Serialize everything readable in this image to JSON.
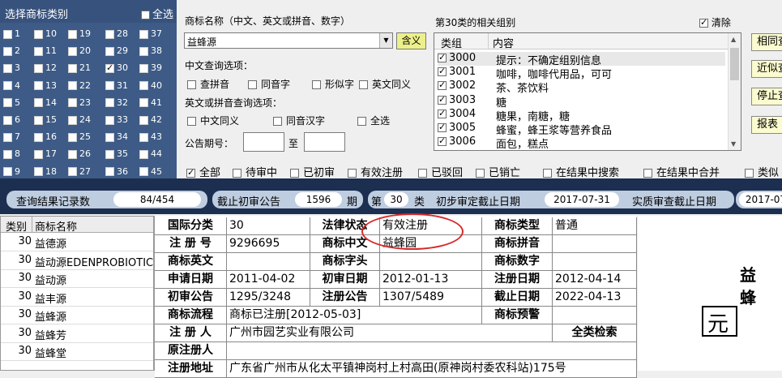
{
  "cat_panel": {
    "title": "选择商标类别",
    "all_label": "全选",
    "classes": [
      {
        "n": "1",
        "on": false
      },
      {
        "n": "2",
        "on": false
      },
      {
        "n": "3",
        "on": false
      },
      {
        "n": "4",
        "on": false
      },
      {
        "n": "5",
        "on": false
      },
      {
        "n": "6",
        "on": false
      },
      {
        "n": "7",
        "on": false
      },
      {
        "n": "8",
        "on": false
      },
      {
        "n": "9",
        "on": false
      },
      {
        "n": "10",
        "on": false
      },
      {
        "n": "11",
        "on": false
      },
      {
        "n": "12",
        "on": false
      },
      {
        "n": "13",
        "on": false
      },
      {
        "n": "14",
        "on": false
      },
      {
        "n": "15",
        "on": false
      },
      {
        "n": "16",
        "on": false
      },
      {
        "n": "17",
        "on": false
      },
      {
        "n": "18",
        "on": false
      },
      {
        "n": "19",
        "on": false
      },
      {
        "n": "20",
        "on": false
      },
      {
        "n": "21",
        "on": false
      },
      {
        "n": "22",
        "on": false
      },
      {
        "n": "23",
        "on": false
      },
      {
        "n": "24",
        "on": false
      },
      {
        "n": "25",
        "on": false
      },
      {
        "n": "26",
        "on": false
      },
      {
        "n": "27",
        "on": false
      },
      {
        "n": "28",
        "on": false
      },
      {
        "n": "29",
        "on": false
      },
      {
        "n": "30",
        "on": true
      },
      {
        "n": "31",
        "on": false
      },
      {
        "n": "32",
        "on": false
      },
      {
        "n": "33",
        "on": false
      },
      {
        "n": "34",
        "on": false
      },
      {
        "n": "35",
        "on": false
      },
      {
        "n": "36",
        "on": false
      },
      {
        "n": "37",
        "on": false
      },
      {
        "n": "38",
        "on": false
      },
      {
        "n": "39",
        "on": false
      },
      {
        "n": "40",
        "on": false
      },
      {
        "n": "41",
        "on": false
      },
      {
        "n": "42",
        "on": false
      },
      {
        "n": "43",
        "on": false
      },
      {
        "n": "44",
        "on": false
      },
      {
        "n": "45",
        "on": false
      }
    ]
  },
  "search": {
    "name_label": "商标名称（中文、英文或拼音、数字）",
    "name_value": "益蜂源",
    "hanyi_btn": "含义",
    "cn_options_label": "中文查询选项：",
    "cn_options": [
      "查拼音",
      "同音字",
      "形似字",
      "英文同义"
    ],
    "en_options_label": "英文或拼音查询选项：",
    "en_options": [
      "中文同义",
      "同音汉字",
      "全选"
    ],
    "issue_label": "公告期号：",
    "issue_to": "至"
  },
  "groups": {
    "title": "第30类的相关组别",
    "clear_label": "清除",
    "clear_on": true,
    "col_code": "类组",
    "col_desc": "内容",
    "rows": [
      {
        "code": "3000",
        "desc": "提示：不确定组别信息",
        "on": true
      },
      {
        "code": "3001",
        "desc": "咖啡，咖啡代用品，可可",
        "on": true
      },
      {
        "code": "3002",
        "desc": "茶、茶饮料",
        "on": true
      },
      {
        "code": "3003",
        "desc": "糖",
        "on": true
      },
      {
        "code": "3004",
        "desc": "糖果，南糖，糖",
        "on": true
      },
      {
        "code": "3005",
        "desc": "蜂蜜，蜂王浆等营养食品",
        "on": true
      },
      {
        "code": "3006",
        "desc": "面包，糕点",
        "on": true
      }
    ]
  },
  "right_buttons": [
    "相同查",
    "近似查",
    "停止查",
    "报表"
  ],
  "filters": [
    {
      "label": "全部",
      "on": true
    },
    {
      "label": "待审中",
      "on": false
    },
    {
      "label": "已初审",
      "on": false
    },
    {
      "label": "有效注册",
      "on": false
    },
    {
      "label": "已驳回",
      "on": false
    },
    {
      "label": "已销亡",
      "on": false
    },
    {
      "label": "在结果中搜索",
      "on": false
    },
    {
      "label": "在结果中合并",
      "on": false
    },
    {
      "label": "类似",
      "on": false
    }
  ],
  "info": {
    "count_label": "查询结果记录数",
    "count_value": "84/454",
    "deadline_label": "截止初审公告",
    "deadline_value": "1596",
    "deadline_unit": "期",
    "class_prefix": "第",
    "class_value": "30",
    "class_suffix": "类",
    "pre_label": "初步审定截止日期",
    "pre_value": "2017-07-31",
    "real_label": "实质审查截止日期",
    "real_value": "2017-07"
  },
  "list": {
    "col_class": "类别",
    "col_name": "商标名称",
    "rows": [
      {
        "n": "30",
        "name": "益德源"
      },
      {
        "n": "30",
        "name": "益动源EDENPROBIOTIC"
      },
      {
        "n": "30",
        "name": "益动源"
      },
      {
        "n": "30",
        "name": "益丰源"
      },
      {
        "n": "30",
        "name": "益蜂源"
      },
      {
        "n": "30",
        "name": "益蜂芳"
      },
      {
        "n": "30",
        "name": "益蜂堂"
      }
    ]
  },
  "detail": {
    "intl_class_k": "国际分类",
    "intl_class_v": "30",
    "legal_k": "法律状态",
    "legal_v": "有效注册",
    "type_k": "商标类型",
    "type_v": "普通",
    "reg_no_k": "注 册 号",
    "reg_no_v": "9296695",
    "cn_k": "商标中文",
    "cn_v": "益蜂园",
    "py_k": "商标拼音",
    "py_v": "",
    "en_k": "商标英文",
    "en_v": "",
    "letter_k": "商标字头",
    "letter_v": "",
    "num_k": "商标数字",
    "num_v": "",
    "apply_k": "申请日期",
    "apply_v": "2011-04-02",
    "first_date_k": "初审日期",
    "first_date_v": "2012-01-13",
    "reg_date_k": "注册日期",
    "reg_date_v": "2012-04-14",
    "first_pub_k": "初审公告",
    "first_pub_v": "1295/3248",
    "reg_pub_k": "注册公告",
    "reg_pub_v": "1307/5489",
    "expire_k": "截止日期",
    "expire_v": "2022-04-13",
    "flow_k": "商标流程",
    "flow_v": "商标已注册[2012-05-03]",
    "warn_k": "商标预警",
    "warn_v": "",
    "reg_person_k": "注 册 人",
    "reg_person_v": "广州市园艺实业有限公司",
    "all_search": "全类检索",
    "orig_k": "原注册人",
    "orig_v": "",
    "addr_k": "注册地址",
    "addr_v": "广东省广州市从化太平镇神岗村上村高田(原神岗村委农科站)175号"
  },
  "logo": {
    "line1": "益",
    "line2": "蜂",
    "box": "元"
  }
}
